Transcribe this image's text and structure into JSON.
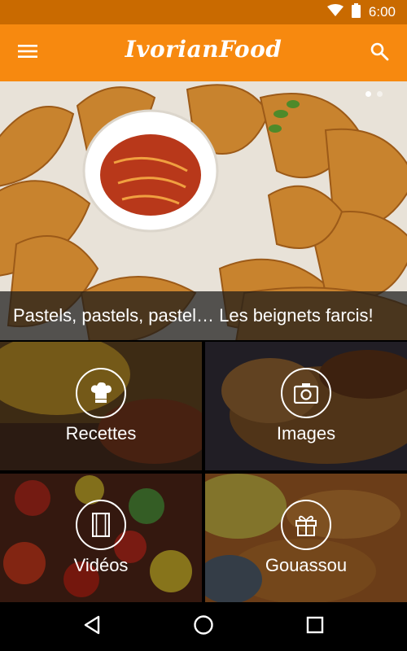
{
  "status_bar": {
    "time": "6:00",
    "icons": [
      "wifi-icon",
      "battery-icon"
    ]
  },
  "app_bar": {
    "title": "IvorianFood",
    "icons": [
      "menu-icon",
      "search-icon"
    ],
    "color": "#f7890f"
  },
  "hero": {
    "caption": "Pastels, pastels, pastel… Les beignets farcis!",
    "carousel": {
      "count": 2,
      "active": 1
    }
  },
  "categories": [
    {
      "label": "Recettes",
      "icon": "chef-hat-icon"
    },
    {
      "label": "Images",
      "icon": "camera-icon"
    },
    {
      "label": "Vidéos",
      "icon": "film-icon"
    },
    {
      "label": "Gouassou",
      "icon": "gift-icon"
    }
  ],
  "nav_bar": {
    "icons": [
      "back-icon",
      "home-icon",
      "recents-icon"
    ]
  }
}
